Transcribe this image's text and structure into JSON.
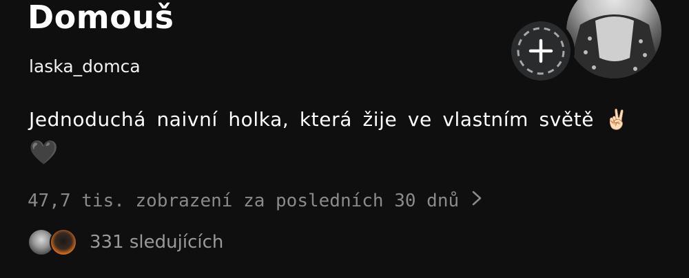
{
  "profile": {
    "display_name": "Domouš",
    "username": "laska_domca",
    "bio_line1": "Jednoduchá naivní holka, která žije ve vlastním světě ✌🏻",
    "bio_line2": "🖤",
    "views_text": "47,7 tis. zobrazení za posledních 30 dnů",
    "followers_text": "331 sledujících"
  },
  "icons": {
    "views_chevron": "chevron-right-icon",
    "add_story": "plus-icon"
  },
  "colors": {
    "background": "#0f0f10",
    "text_primary": "#ffffff",
    "text_secondary": "#8a8a8a"
  }
}
